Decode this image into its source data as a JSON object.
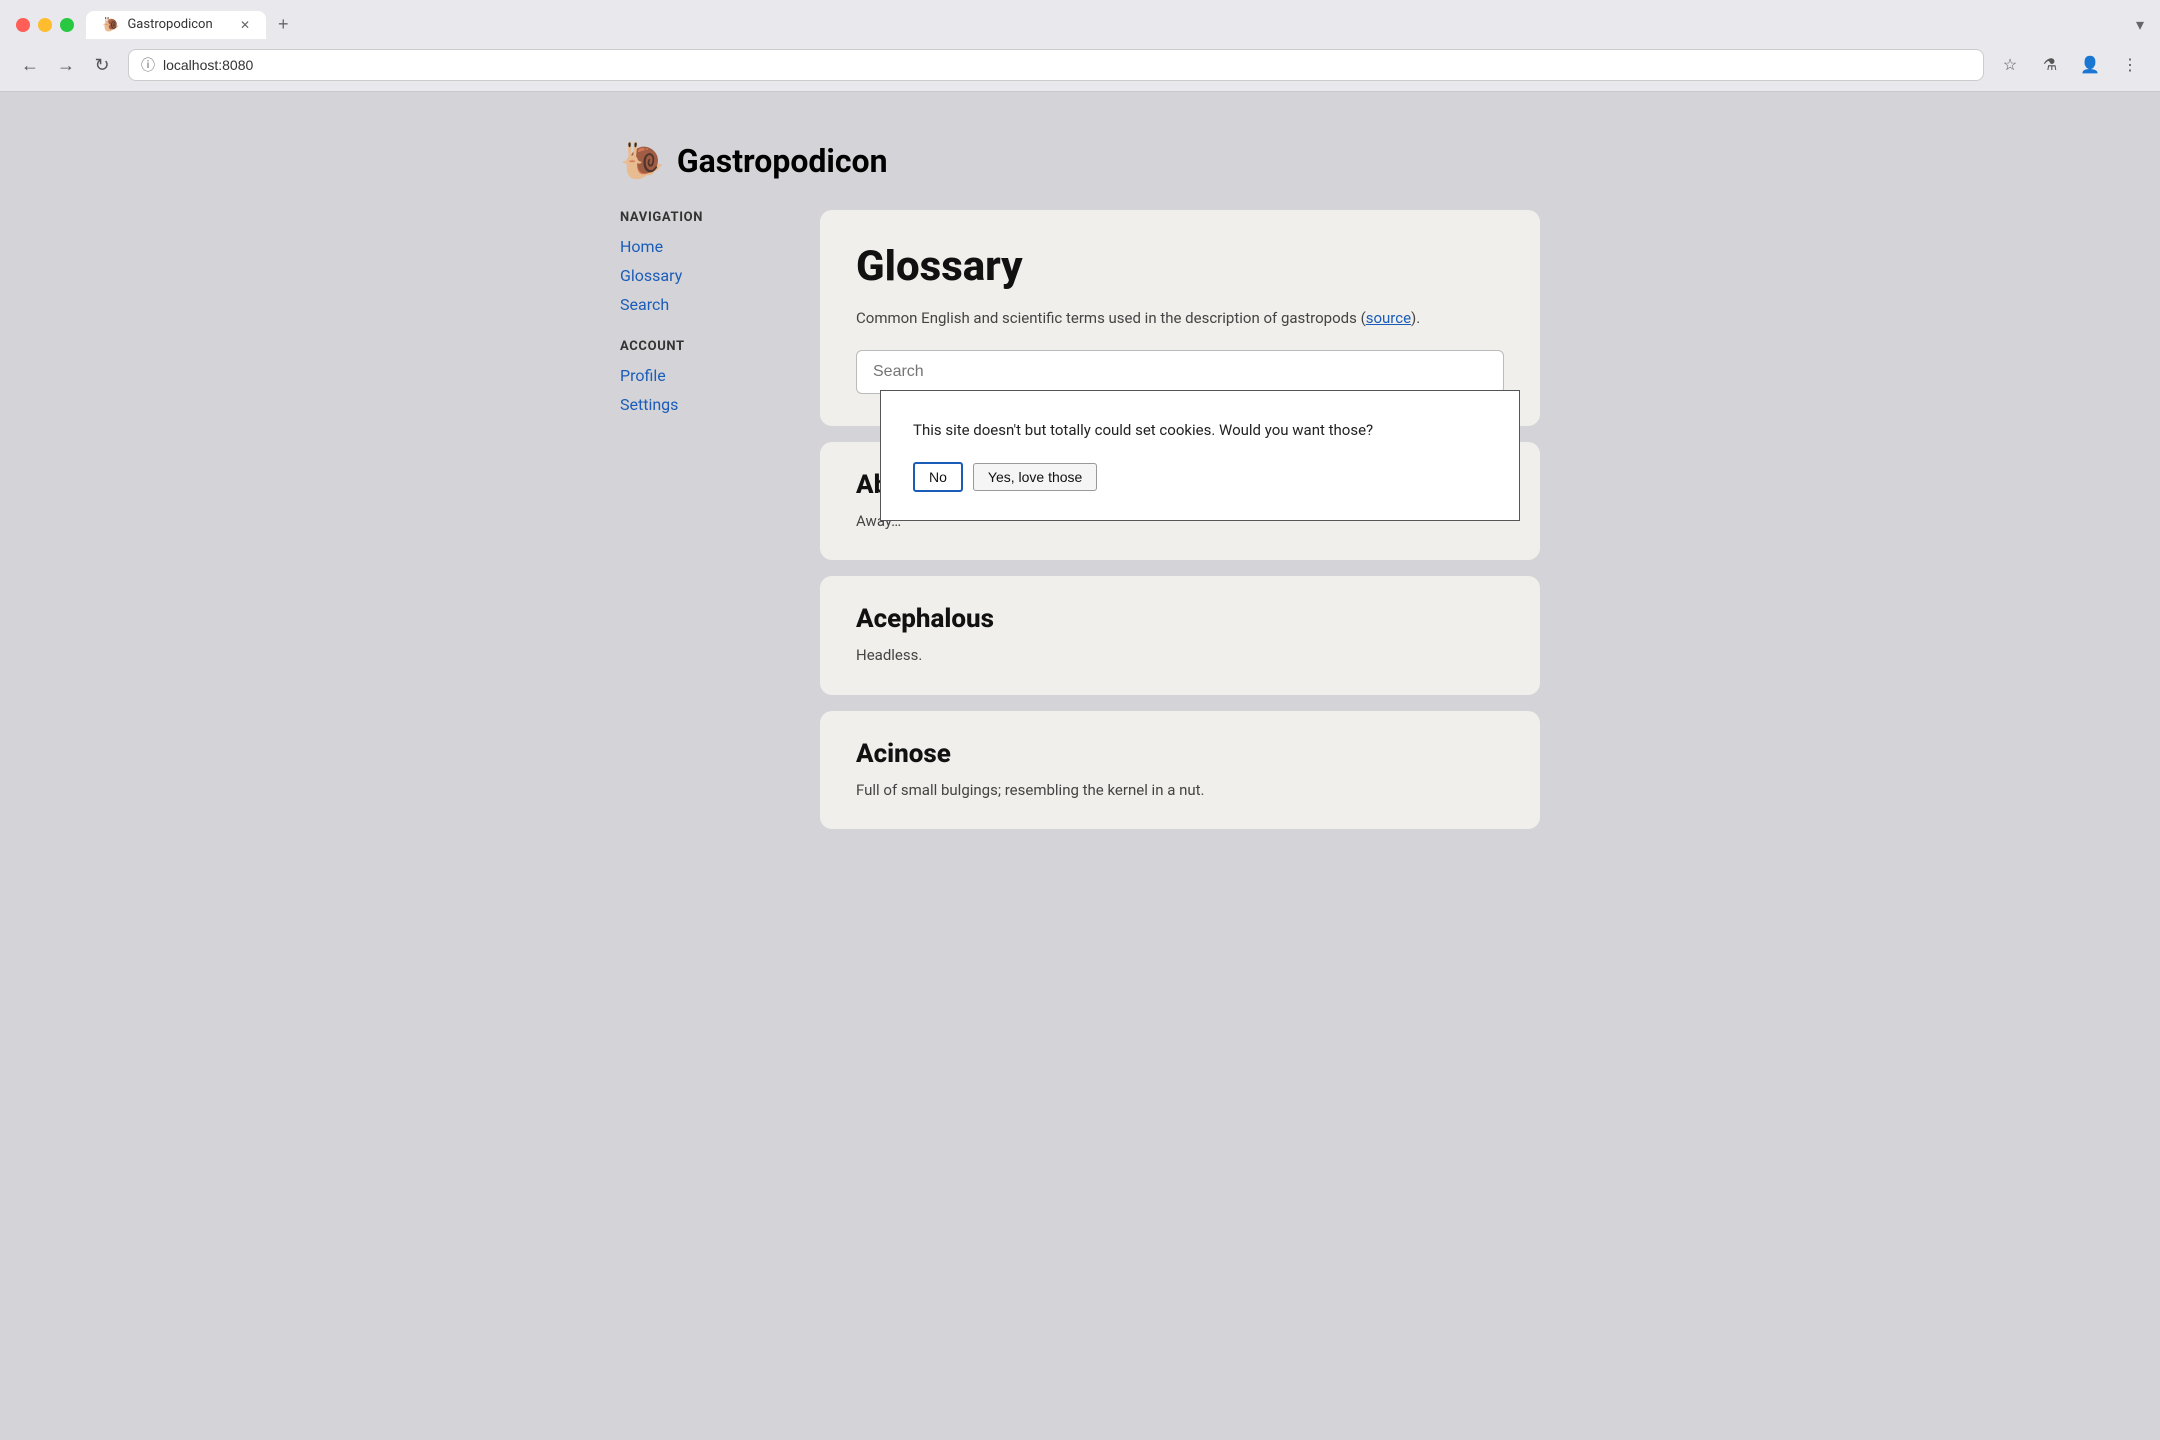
{
  "browser": {
    "traffic_lights": [
      "red",
      "yellow",
      "green"
    ],
    "tab": {
      "favicon": "🐌",
      "title": "Gastropodicon",
      "close": "✕"
    },
    "new_tab": "+",
    "dropdown": "▾",
    "nav": {
      "back": "←",
      "forward": "→",
      "reload": "↻"
    },
    "address": {
      "icon": "ⓘ",
      "url": "localhost:8080"
    },
    "toolbar": {
      "bookmark": "☆",
      "flask": "⚗",
      "profile": "👤",
      "menu": "⋮"
    }
  },
  "site": {
    "icon": "🐌",
    "title": "Gastropodicon"
  },
  "sidebar": {
    "nav_label": "NAVIGATION",
    "nav_links": [
      {
        "label": "Home",
        "href": "#"
      },
      {
        "label": "Glossary",
        "href": "#"
      },
      {
        "label": "Search",
        "href": "#"
      }
    ],
    "account_label": "ACCOUNT",
    "account_links": [
      {
        "label": "Profile",
        "href": "#"
      },
      {
        "label": "Settings",
        "href": "#"
      }
    ]
  },
  "glossary": {
    "title": "Glossary",
    "description": "Common English and scientific terms used in the description of gastropods (",
    "source_link": "source",
    "description_end": ").",
    "search_placeholder": "Search"
  },
  "cookie_dialog": {
    "text": "This site doesn't but totally could set cookies. Would you want those?",
    "btn_no": "No",
    "btn_yes": "Yes, love those"
  },
  "terms": [
    {
      "title": "Aba…",
      "definition": "Away…"
    },
    {
      "title": "Acephalous",
      "definition": "Headless."
    },
    {
      "title": "Acinose",
      "definition": "Full of small bulgings; resembling the kernel in a nut."
    }
  ]
}
